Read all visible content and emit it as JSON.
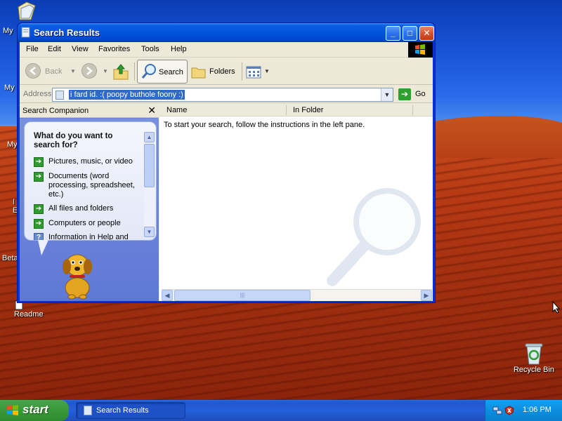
{
  "desktop": {
    "icons": [
      {
        "label": "My"
      },
      {
        "label": "My"
      },
      {
        "label": "My"
      },
      {
        "label": "I"
      },
      {
        "label": "E"
      },
      {
        "label": "Beta"
      },
      {
        "label": "Readme"
      },
      {
        "label": "Recycle Bin"
      }
    ]
  },
  "window": {
    "title": "Search Results",
    "controls": {
      "minimize": "_",
      "maximize": "□",
      "close": "✕"
    },
    "menu": [
      "File",
      "Edit",
      "View",
      "Favorites",
      "Tools",
      "Help"
    ],
    "toolbar": {
      "back": "Back",
      "search": "Search",
      "folders": "Folders"
    },
    "address": {
      "label": "Address",
      "value": "i fard id. :( poopy buthole foony :)",
      "go": "Go"
    },
    "search_companion": {
      "title": "Search Companion",
      "close": "✕",
      "heading": "What do you want to search for?",
      "options": [
        "Pictures, music, or video",
        "Documents (word processing, spreadsheet, etc.)",
        "All files and folders",
        "Computers or people",
        "Information in Help and"
      ]
    },
    "results": {
      "columns": [
        "Name",
        "In Folder"
      ],
      "message": "To start your search, follow the instructions in the left pane."
    }
  },
  "taskbar": {
    "start": "start",
    "task": "Search Results",
    "clock": "1:06 PM"
  },
  "colors": {
    "titlebar": "#0453db",
    "start_button": "#3c9a3c",
    "taskbar": "#245fdb",
    "selection": "#316ac5"
  }
}
